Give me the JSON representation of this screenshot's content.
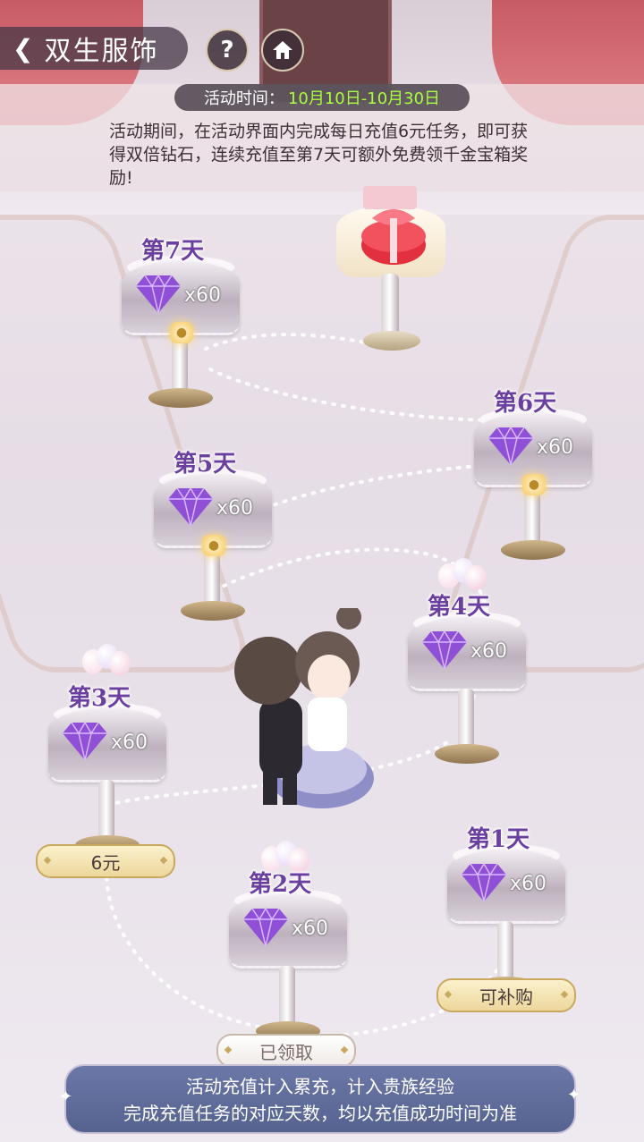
{
  "header": {
    "back_icon": "back-arrow-icon",
    "title": "双生服饰",
    "help_icon": "question-icon",
    "home_icon": "home-icon"
  },
  "event": {
    "time_label": "活动时间：",
    "time_range": "10月10日-10月30日",
    "description": "活动期间，在活动界面内完成每日充值6元任务，即可获得双倍钻石，连续充值至第7天可额外免费领千金宝箱奖励!"
  },
  "days": [
    {
      "label": "第1天",
      "count": "x60",
      "reward_icon": "purple-diamond-icon",
      "status": "available",
      "button": "可补购"
    },
    {
      "label": "第2天",
      "count": "x60",
      "reward_icon": "purple-diamond-icon",
      "status": "claimed",
      "button": "已领取"
    },
    {
      "label": "第3天",
      "count": "x60",
      "reward_icon": "purple-diamond-icon",
      "status": "current",
      "button": "6元"
    },
    {
      "label": "第4天",
      "count": "x60",
      "reward_icon": "purple-diamond-icon",
      "status": "unlocked",
      "button": ""
    },
    {
      "label": "第5天",
      "count": "x60",
      "reward_icon": "purple-diamond-icon",
      "status": "locked",
      "button": ""
    },
    {
      "label": "第6天",
      "count": "x60",
      "reward_icon": "purple-diamond-icon",
      "status": "locked",
      "button": ""
    },
    {
      "label": "第7天",
      "count": "x60",
      "reward_icon": "purple-diamond-icon",
      "status": "locked",
      "button": ""
    }
  ],
  "bonus": {
    "icon": "treasure-gift-box-icon"
  },
  "footer": {
    "line1": "活动充值计入累充，计入贵族经验",
    "line2": "完成充值任务的对应天数，均以充值成功时间为准"
  },
  "colors": {
    "accent": "#6a3fa0",
    "time_highlight": "#a8ff3c",
    "footer_bg": "#5f6b98"
  }
}
